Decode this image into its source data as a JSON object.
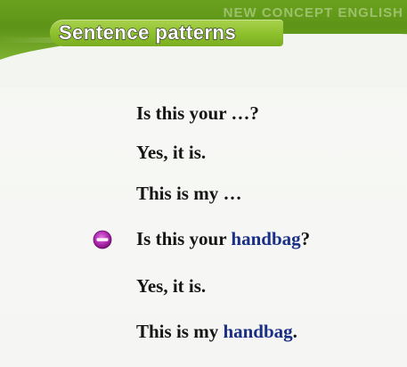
{
  "header": {
    "brand": "NEW CONCEPT ENGLISH",
    "title": "Sentence patterns"
  },
  "colors": {
    "header_green": "#5e9417",
    "title_pill_green": "#8cc02b",
    "text_black": "#151515",
    "highlight_blue": "#1a2f86",
    "bullet_purple": "#b02bb0"
  },
  "sentences": [
    {
      "text": "Is this your …?"
    },
    {
      "text": "Yes, it is."
    },
    {
      "text": "This is my …"
    },
    {
      "before": "Is this your ",
      "highlight": "handbag",
      "after": "?",
      "icon": "purple-disc-bullet-icon"
    },
    {
      "text": "Yes, it is."
    },
    {
      "before": "This is my ",
      "highlight": "handbag",
      "after": "."
    }
  ]
}
